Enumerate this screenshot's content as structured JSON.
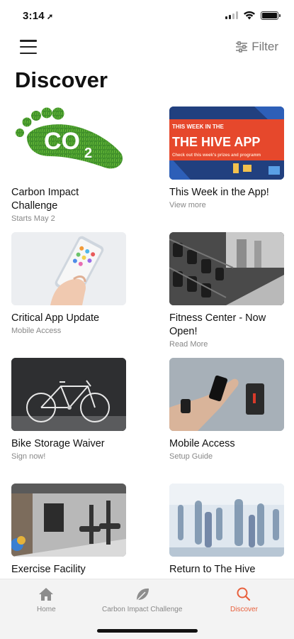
{
  "status_bar": {
    "time": "3:14",
    "location_glyph": "➚"
  },
  "header": {
    "menu_icon": "hamburger-icon",
    "filter_label": "Filter",
    "filter_icon": "sliders-icon"
  },
  "page": {
    "title": "Discover"
  },
  "cards": [
    {
      "title": "Carbon Impact Challenge",
      "subtitle": "Starts May 2",
      "image": "co2-footprint-image",
      "logo_text": "CO",
      "logo_subscript": "2"
    },
    {
      "title": "This Week in the App!",
      "subtitle": "View more",
      "image": "hive-app-banner-image",
      "banner_kicker": "THIS WEEK IN THE",
      "banner_title": "THE HIVE APP",
      "banner_caption": "Check out this week's prizes and programm"
    },
    {
      "title": "Critical App Update",
      "subtitle": "Mobile Access",
      "image": "phone-in-hand-image"
    },
    {
      "title": "Fitness Center - Now Open!",
      "subtitle": "Read More",
      "image": "dumbbell-rack-image"
    },
    {
      "title": "Bike Storage Waiver",
      "subtitle": "Sign now!",
      "image": "bicycle-image"
    },
    {
      "title": "Mobile Access",
      "subtitle": "Setup Guide",
      "image": "phone-access-reader-image"
    },
    {
      "title": "Exercise Facility",
      "subtitle": "",
      "image": "gym-room-image"
    },
    {
      "title": "Return to The Hive",
      "subtitle": "",
      "image": "busy-lobby-image"
    }
  ],
  "tabs": [
    {
      "label": "Home",
      "icon": "home-icon",
      "active": false
    },
    {
      "label": "Carbon Impact Challenge",
      "icon": "leaf-icon",
      "active": false
    },
    {
      "label": "Discover",
      "icon": "search-icon",
      "active": true
    }
  ],
  "colors": {
    "accent": "#e8603c",
    "banner_red": "#e6482c",
    "grass_green": "#3f8f2a"
  }
}
